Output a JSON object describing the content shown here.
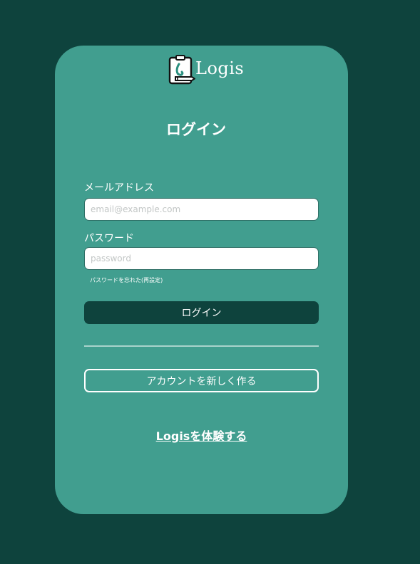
{
  "brand": {
    "name": "Logis",
    "logo_icon": "clipboard-pen-icon"
  },
  "login": {
    "title": "ログイン",
    "email_label": "メールアドレス",
    "email_placeholder": "email@example.com",
    "email_value": "",
    "password_label": "パスワード",
    "password_placeholder": "password",
    "password_value": "",
    "forgot_link": "パスワードを忘れた(再設定)",
    "submit_label": "ログイン"
  },
  "signup": {
    "label": "アカウントを新しく作る"
  },
  "demo": {
    "label": "Logisを体験する"
  },
  "colors": {
    "page_background": "#0e433d",
    "card_background": "#419e8f",
    "primary_button": "#0e433d",
    "text": "#ffffff"
  }
}
